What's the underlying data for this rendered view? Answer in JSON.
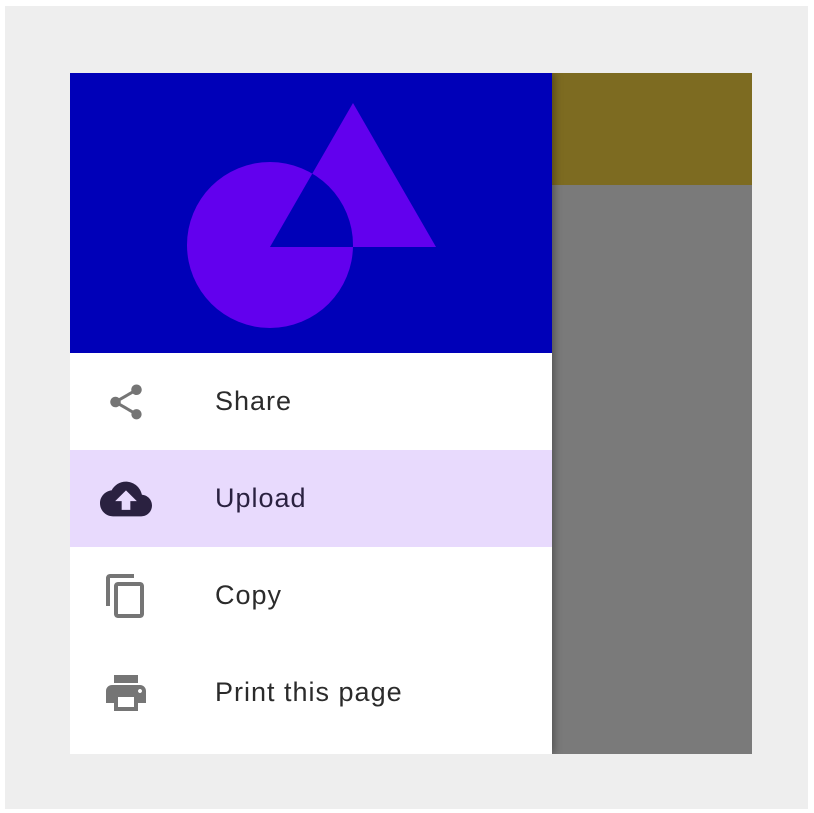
{
  "drawer": {
    "header_color": "#0000b8",
    "shape_color": "#6200ee",
    "items": [
      {
        "label": "Share",
        "icon": "share-icon",
        "active": false
      },
      {
        "label": "Upload",
        "icon": "cloud-upload-icon",
        "active": true
      },
      {
        "label": "Copy",
        "icon": "copy-icon",
        "active": false
      },
      {
        "label": "Print this page",
        "icon": "print-icon",
        "active": false
      }
    ]
  },
  "colors": {
    "active_item_bg": "#e8dafd",
    "app_topbar": "#7d6b21",
    "scrim_surface": "#7a7a7a",
    "icon_gray": "#757575",
    "icon_dark": "#2a2140"
  }
}
